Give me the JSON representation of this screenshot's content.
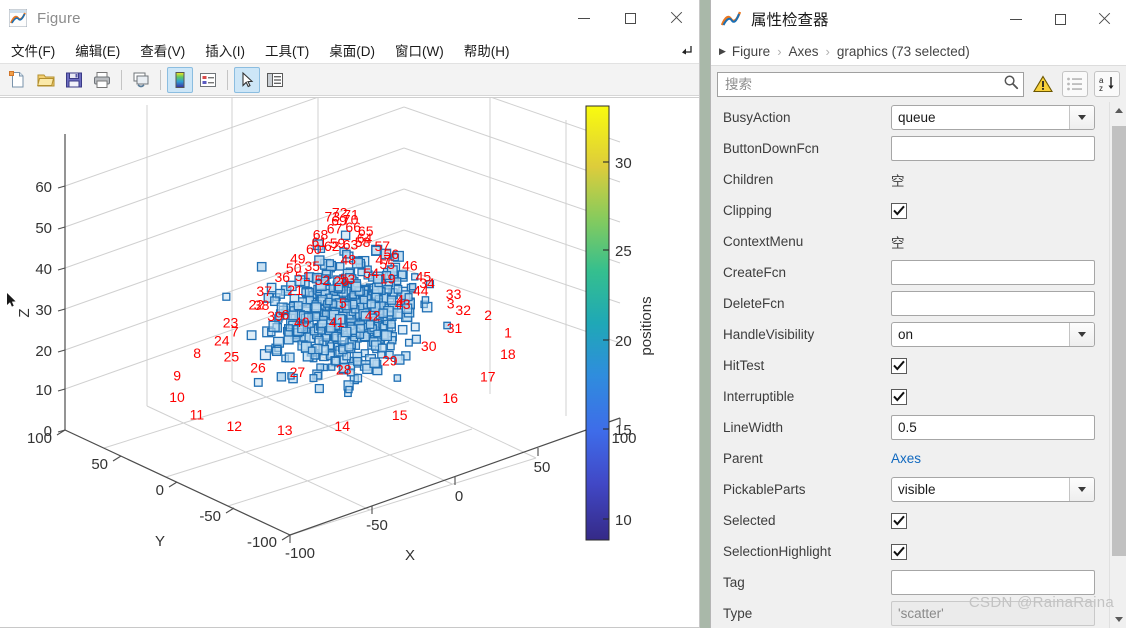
{
  "figure_window": {
    "title": "Figure",
    "icon": "matlab-membrane-icon",
    "controls": {
      "minimize": "–",
      "maximize": "□",
      "close": "✕"
    },
    "menu": [
      {
        "label": "文件(F)",
        "name": "menu-file"
      },
      {
        "label": "编辑(E)",
        "name": "menu-edit"
      },
      {
        "label": "查看(V)",
        "name": "menu-view"
      },
      {
        "label": "插入(I)",
        "name": "menu-insert"
      },
      {
        "label": "工具(T)",
        "name": "menu-tools"
      },
      {
        "label": "桌面(D)",
        "name": "menu-desktop"
      },
      {
        "label": "窗口(W)",
        "name": "menu-window"
      },
      {
        "label": "帮助(H)",
        "name": "menu-help"
      }
    ],
    "menu_expander_icon": "expand-arrow-icon",
    "toolbar": [
      {
        "name": "new-figure-icon",
        "active": false
      },
      {
        "name": "open-file-icon",
        "active": false
      },
      {
        "name": "save-figure-icon",
        "active": false
      },
      {
        "name": "print-figure-icon",
        "active": false
      },
      {
        "name": "link-plot-icon",
        "active": false
      },
      {
        "name": "insert-colorbar-icon",
        "active": true
      },
      {
        "name": "insert-legend-icon",
        "active": false
      },
      {
        "name": "pointer-select-icon",
        "active": true
      },
      {
        "name": "property-inspector-icon",
        "active": false
      }
    ]
  },
  "chart_data": {
    "type": "scatter",
    "title": "",
    "projection": "3d",
    "xlabel": "X",
    "ylabel": "Y",
    "zlabel": "Z",
    "xticks": [
      -100,
      -50,
      0,
      50,
      100
    ],
    "yticks": [
      -100,
      -50,
      0,
      50,
      100
    ],
    "zticks": [
      0,
      10,
      20,
      30,
      40,
      50,
      60
    ],
    "xlim": [
      -100,
      100
    ],
    "ylim": [
      -100,
      100
    ],
    "zlim": [
      0,
      60
    ],
    "grid": true,
    "marker": "square",
    "marker_edge_color": "#1f6fb4",
    "marker_face_color": "#b8d8ef",
    "label_color": "#ff0000",
    "point_count": 73,
    "colorbar": {
      "label": "positions",
      "colormap": "parula",
      "ticks": [
        10,
        15,
        20,
        25,
        30
      ],
      "lim": [
        7.5,
        33
      ]
    },
    "point_labels": [
      "1",
      "2",
      "3",
      "4",
      "5",
      "6",
      "7",
      "8",
      "9",
      "10",
      "11",
      "12",
      "13",
      "14",
      "15",
      "16",
      "17",
      "18",
      "19",
      "20",
      "21",
      "22",
      "23",
      "24",
      "25",
      "26",
      "27",
      "28",
      "29",
      "30",
      "31",
      "32",
      "33",
      "34",
      "35",
      "36",
      "37",
      "38",
      "39",
      "40",
      "41",
      "42",
      "43",
      "44",
      "45",
      "46",
      "47",
      "48",
      "49",
      "50",
      "51",
      "52",
      "53",
      "54",
      "55",
      "56",
      "57",
      "58",
      "59",
      "60",
      "61",
      "62",
      "63",
      "64",
      "65",
      "66",
      "67",
      "68",
      "69",
      "70",
      "71",
      "72",
      "73"
    ]
  },
  "inspector": {
    "title": "属性检查器",
    "icon": "matlab-membrane-icon",
    "controls": {
      "minimize": "–",
      "maximize": "□",
      "close": "✕"
    },
    "breadcrumb": {
      "caret_icon": "caret-right-icon",
      "items": [
        "Figure",
        "Axes",
        "graphics (73 selected)"
      ],
      "separator": "›"
    },
    "search": {
      "placeholder": "搜索",
      "value": "",
      "icon": "search-icon"
    },
    "toolbar_buttons": [
      {
        "name": "warning-icon",
        "label": "⚠"
      },
      {
        "name": "group-by-category-icon",
        "label": ""
      },
      {
        "name": "sort-alphabetical-icon",
        "label": ""
      }
    ],
    "properties": [
      {
        "name": "BusyAction",
        "kind": "combo",
        "value": "queue"
      },
      {
        "name": "ButtonDownFcn",
        "kind": "input",
        "value": ""
      },
      {
        "name": "Children",
        "kind": "text",
        "value": "空"
      },
      {
        "name": "Clipping",
        "kind": "checkbox",
        "value": true
      },
      {
        "name": "ContextMenu",
        "kind": "text",
        "value": "空"
      },
      {
        "name": "CreateFcn",
        "kind": "input",
        "value": ""
      },
      {
        "name": "DeleteFcn",
        "kind": "input",
        "value": ""
      },
      {
        "name": "HandleVisibility",
        "kind": "combo",
        "value": "on"
      },
      {
        "name": "HitTest",
        "kind": "checkbox",
        "value": true
      },
      {
        "name": "Interruptible",
        "kind": "checkbox",
        "value": true
      },
      {
        "name": "LineWidth",
        "kind": "input",
        "value": "0.5"
      },
      {
        "name": "Parent",
        "kind": "link",
        "value": "Axes"
      },
      {
        "name": "PickableParts",
        "kind": "combo",
        "value": "visible"
      },
      {
        "name": "Selected",
        "kind": "checkbox",
        "value": true
      },
      {
        "name": "SelectionHighlight",
        "kind": "checkbox",
        "value": true
      },
      {
        "name": "Tag",
        "kind": "input",
        "value": ""
      },
      {
        "name": "Type",
        "kind": "readonly",
        "value": "'scatter'"
      }
    ],
    "scrollbar": {
      "up_icon": "scroll-up-icon",
      "down_icon": "scroll-down-icon"
    }
  },
  "watermark": "CSDN @RainaRaina",
  "colors": {
    "accent_blue": "#1068bf",
    "marker_blue": "#1f6fb4",
    "label_red": "#ff0000",
    "toolbar_active": "#cde6f7"
  }
}
